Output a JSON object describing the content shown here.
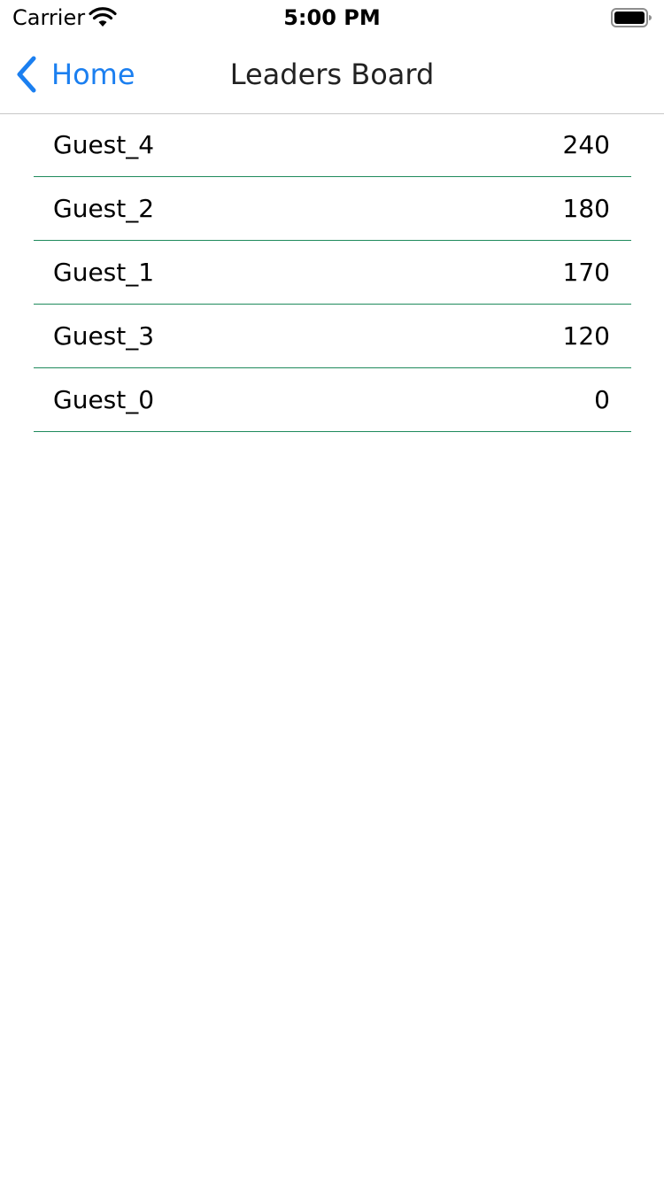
{
  "status_bar": {
    "carrier": "Carrier",
    "time": "5:00 PM",
    "wifi_icon": "wifi-icon",
    "battery_icon": "battery-icon"
  },
  "nav": {
    "back_label": "Home",
    "back_icon": "chevron-left-icon",
    "title": "Leaders Board"
  },
  "colors": {
    "accent": "#1b7ff0",
    "row_divider": "#1f8a5c",
    "nav_border": "#c8c8c8"
  },
  "leaders": [
    {
      "name": "Guest_4",
      "score": "240"
    },
    {
      "name": "Guest_2",
      "score": "180"
    },
    {
      "name": "Guest_1",
      "score": "170"
    },
    {
      "name": "Guest_3",
      "score": "120"
    },
    {
      "name": "Guest_0",
      "score": "0"
    }
  ]
}
